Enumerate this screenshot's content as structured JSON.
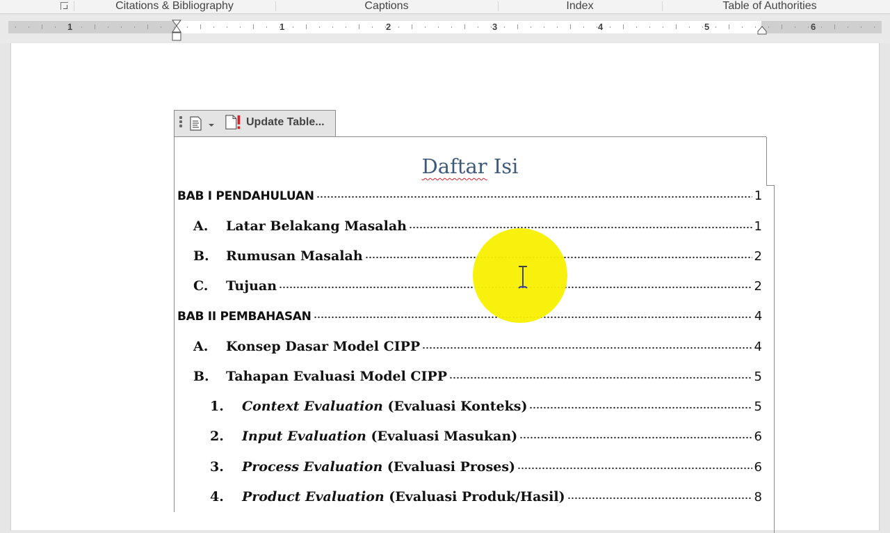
{
  "ribbon": {
    "groups": [
      {
        "label": "Citations & Bibliography"
      },
      {
        "label": "Captions"
      },
      {
        "label": "Index"
      },
      {
        "label": "Table of Authorities"
      }
    ],
    "dialog_launcher_icon": "dialog-launcher-icon"
  },
  "ruler": {
    "labels": [
      "1",
      "1",
      "2",
      "3",
      "4",
      "5",
      "6"
    ]
  },
  "toc_control": {
    "menu_icon": "document-list-icon",
    "dropdown_icon": "chevron-down-icon",
    "update_icon": "document-exclamation-icon",
    "update_label": "Update Table..."
  },
  "document": {
    "title_word1": "Daftar",
    "title_word2": "Isi",
    "entries": [
      {
        "level": 1,
        "num": "",
        "text": "BAB I PENDAHULUAN",
        "italic": "",
        "page": "1"
      },
      {
        "level": 2,
        "num": "A.",
        "text": "Latar Belakang Masalah",
        "italic": "",
        "page": "1"
      },
      {
        "level": 2,
        "num": "B.",
        "text": "Rumusan Masalah",
        "italic": "",
        "page": "2"
      },
      {
        "level": 2,
        "num": "C.",
        "text": "Tujuan",
        "italic": "",
        "page": "2"
      },
      {
        "level": 1,
        "num": "",
        "text": "BAB II PEMBAHASAN",
        "italic": "",
        "page": "4"
      },
      {
        "level": 2,
        "num": "A.",
        "text": "Konsep Dasar Model CIPP",
        "italic": "",
        "page": "4"
      },
      {
        "level": 2,
        "num": "B.",
        "text": "Tahapan Evaluasi Model CIPP",
        "italic": "",
        "page": "5"
      },
      {
        "level": 3,
        "num": "1.",
        "italic": "Context Evaluation",
        "text": " (Evaluasi Konteks)",
        "page": "5"
      },
      {
        "level": 3,
        "num": "2.",
        "italic": "Input Evaluation",
        "text": " (Evaluasi Masukan)",
        "page": "6"
      },
      {
        "level": 3,
        "num": "3.",
        "italic": "Process Evaluation",
        "text": " (Evaluasi Proses)",
        "page": "6"
      },
      {
        "level": 3,
        "num": "4.",
        "italic": "Product Evaluation",
        "text": " (Evaluasi Produk/Hasil)",
        "page": "8"
      }
    ]
  },
  "cursor": {
    "type": "i-beam",
    "highlight_color": "#f8f000"
  },
  "colors": {
    "title": "#3e5a78",
    "spellcheck_underline": "#e0202a"
  }
}
